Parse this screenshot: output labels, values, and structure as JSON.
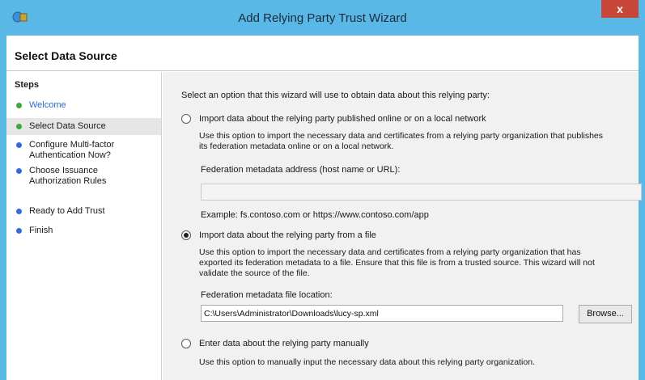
{
  "window": {
    "title": "Add Relying Party Trust Wizard",
    "close_label": "x"
  },
  "header": {
    "title": "Select Data Source"
  },
  "steps": {
    "title": "Steps",
    "items": [
      {
        "label": "Welcome"
      },
      {
        "label": "Select Data Source"
      },
      {
        "label": "Configure Multi-factor",
        "label2": "Authentication Now?"
      },
      {
        "label": "Choose Issuance",
        "label2": "Authorization Rules"
      },
      {
        "label": "Ready to Add Trust"
      },
      {
        "label": "Finish"
      }
    ]
  },
  "main": {
    "intro": "Select an option that this wizard will use to obtain data about this relying party:",
    "option_online": {
      "label": "Import data about the relying party published online or on a local network",
      "desc1": "Use this option to import the necessary data and certificates from a relying party organization that publishes",
      "desc2": "its federation metadata online or on a local network.",
      "field_label": "Federation metadata address (host name or URL):",
      "field_value": "",
      "example": "Example: fs.contoso.com or https://www.contoso.com/app"
    },
    "option_file": {
      "label": "Import data about the relying party from a file",
      "desc1": "Use this option to import the necessary data and certificates from a relying party organization that has",
      "desc2": "exported its federation metadata to a file. Ensure that this file is from a trusted source.  This wizard will not",
      "desc3": "validate the source of the file.",
      "field_label": "Federation metadata file location:",
      "field_value": "C:\\Users\\Administrator\\Downloads\\lucy-sp.xml",
      "browse_label": "Browse..."
    },
    "option_manual": {
      "label": "Enter data about the relying party manually",
      "desc1": "Use this option to manually input the necessary data about this relying party organization."
    },
    "selected_option": "option_file"
  }
}
